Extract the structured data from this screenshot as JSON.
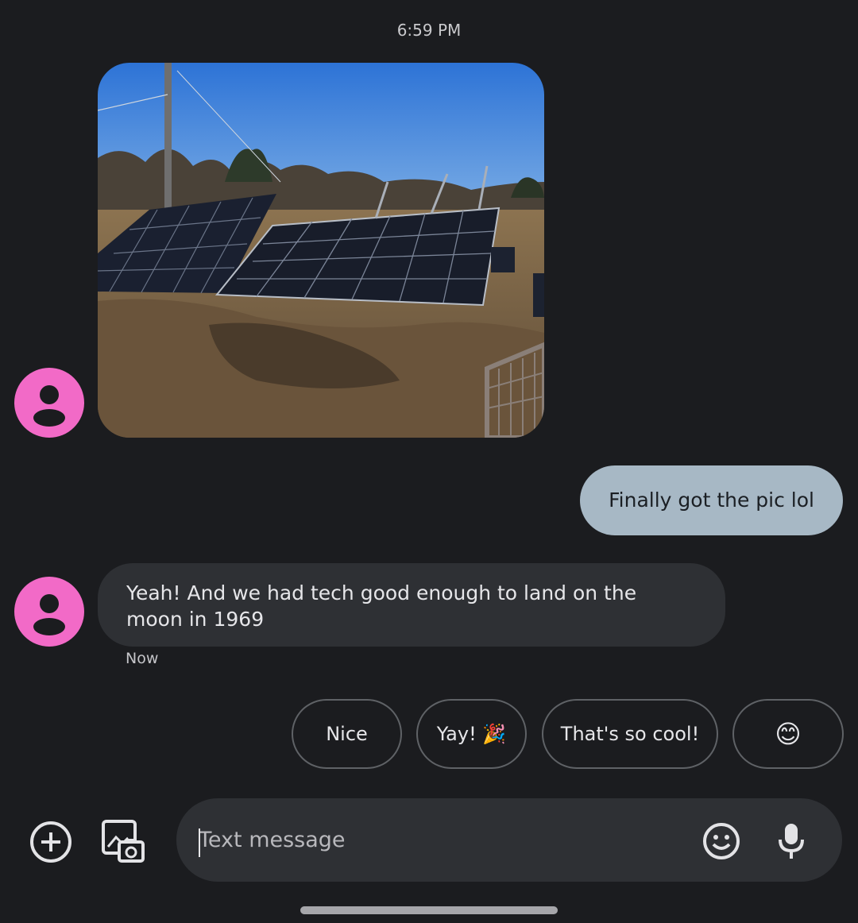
{
  "status": {
    "time": "6:59 PM"
  },
  "thread": {
    "incoming_photo": {
      "alt": "Solar panels in a field"
    },
    "outgoing_message": "Finally got the pic lol",
    "incoming_message": "Yeah! And we had tech good enough to land on the moon in 1969",
    "incoming_message_time": "Now"
  },
  "smart_replies": [
    "Nice",
    "Yay! 🎉",
    "That's so cool!",
    "😊"
  ],
  "compose": {
    "placeholder": "Text message",
    "icons": [
      "add-icon",
      "gallery-camera-icon",
      "emoji-icon",
      "microphone-icon"
    ]
  },
  "colors": {
    "avatar": "#f26ac7",
    "outgoing_bubble": "#a7b8c5",
    "incoming_bubble": "#2e3034",
    "background": "#1b1c1f"
  }
}
